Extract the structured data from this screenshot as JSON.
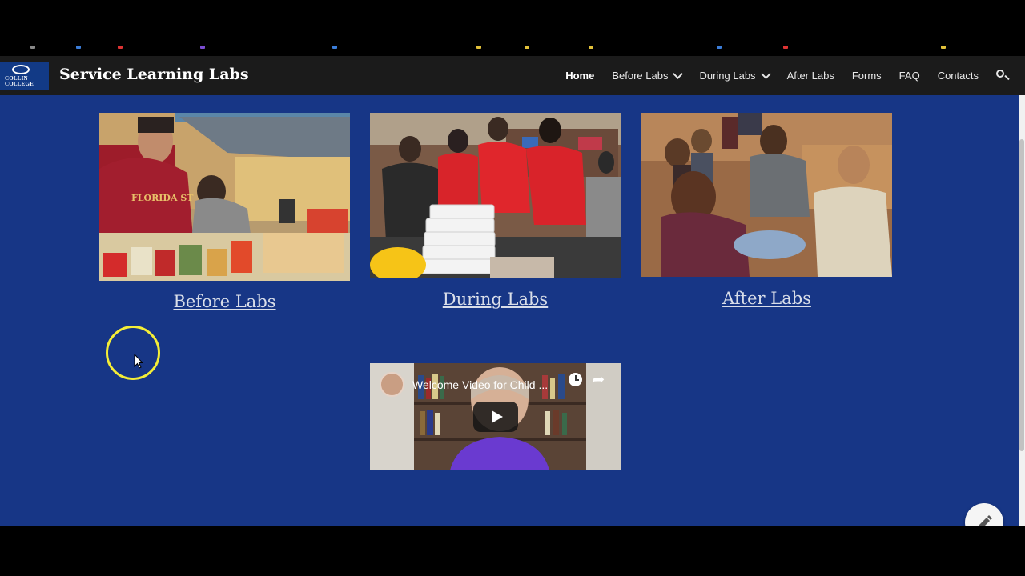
{
  "site": {
    "logo_text": "COLLIN\nCOLLEGE",
    "title": "Service Learning Labs"
  },
  "nav": {
    "items": [
      {
        "label": "Home",
        "active": true,
        "dropdown": false
      },
      {
        "label": "Before Labs",
        "active": false,
        "dropdown": true
      },
      {
        "label": "During Labs",
        "active": false,
        "dropdown": true
      },
      {
        "label": "After Labs",
        "active": false,
        "dropdown": false
      },
      {
        "label": "Forms",
        "active": false,
        "dropdown": false
      },
      {
        "label": "FAQ",
        "active": false,
        "dropdown": false
      },
      {
        "label": "Contacts",
        "active": false,
        "dropdown": false
      }
    ],
    "search_icon": "search-icon"
  },
  "cards": [
    {
      "link": "Before Labs",
      "image": "students packing canned food"
    },
    {
      "link": "During Labs",
      "image": "volunteers in red shirts serving food"
    },
    {
      "link": "After Labs",
      "image": "students sitting in a discussion circle"
    }
  ],
  "video": {
    "title": "Welcome Video for Child ...",
    "icons": [
      "clock-icon",
      "share-icon",
      "play-icon"
    ]
  },
  "colors": {
    "header_bg": "#1b1b1b",
    "page_bg": "#173686",
    "link": "#d9dee9",
    "highlight_ring": "#f5ee37"
  }
}
